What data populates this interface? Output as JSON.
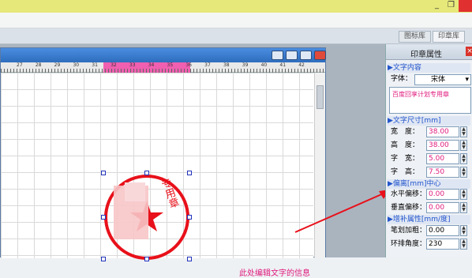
{
  "window": {
    "minimize_glyph": "_",
    "restore_glyph": "❐"
  },
  "tabs": [
    {
      "label": "图标库"
    },
    {
      "label": "印章库"
    }
  ],
  "ruler": {
    "ticks": [
      "27",
      "28",
      "29",
      "30",
      "31",
      "32",
      "33",
      "34",
      "35",
      "36",
      "37",
      "38",
      "39",
      "40",
      "41",
      "42"
    ]
  },
  "stamp": {
    "text": "专用章"
  },
  "annotation": {
    "text": "此处编辑文字的信息"
  },
  "panel": {
    "title": "印章属性",
    "close_glyph": "×",
    "sections": {
      "text_content": "文字内容",
      "text_size": "文字尺寸[mm]",
      "offset": "偏离[mm]中心",
      "advanced": "增补属性[mm/度]"
    },
    "font_label": "字体：",
    "font_value": "宋体",
    "text_value": "百度回享计划专用章",
    "fields": {
      "width": {
        "label": "宽　度：",
        "value": "38.00"
      },
      "height": {
        "label": "高　度：",
        "value": "38.00"
      },
      "char_width": {
        "label": "字　宽：",
        "value": "5.00"
      },
      "char_height": {
        "label": "字　高：",
        "value": "7.50"
      },
      "h_offset": {
        "label": "水平偏移：",
        "value": "0.00"
      },
      "v_offset": {
        "label": "垂直偏移：",
        "value": "0.00"
      },
      "stroke": {
        "label": "笔划加粗：",
        "value": "0.00"
      },
      "ring_angle": {
        "label": "环排角度：",
        "value": "230"
      }
    }
  },
  "colors": {
    "stamp_red": "#e8101a",
    "accent_pink": "#e0197d",
    "title_blue": "#2f6dbd",
    "annotation_pink": "#e0197d"
  }
}
